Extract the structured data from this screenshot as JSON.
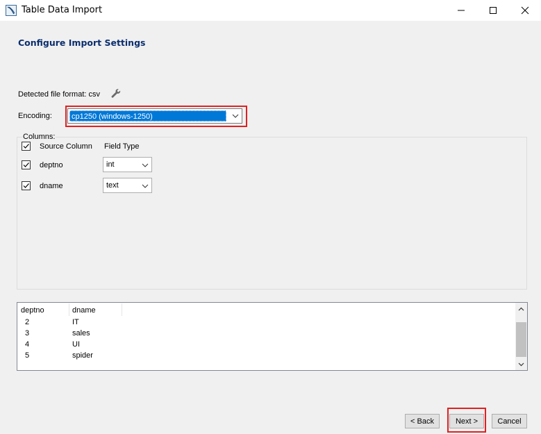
{
  "window": {
    "title": "Table Data Import"
  },
  "page": {
    "heading": "Configure Import Settings"
  },
  "detected_format": {
    "label": "Detected file format: csv",
    "icon": "wrench-icon"
  },
  "encoding": {
    "label": "Encoding:",
    "value": "cp1250 (windows-1250)"
  },
  "columns": {
    "group_label": "Columns:",
    "header_source": "Source Column",
    "header_type": "Field Type",
    "header_checked": true,
    "rows": [
      {
        "checked": true,
        "name": "deptno",
        "type": "int"
      },
      {
        "checked": true,
        "name": "dname",
        "type": "text"
      }
    ]
  },
  "preview": {
    "headers": [
      "deptno",
      "dname"
    ],
    "rows": [
      [
        "2",
        "IT"
      ],
      [
        "3",
        "sales"
      ],
      [
        "4",
        "UI"
      ],
      [
        "5",
        "spider"
      ]
    ]
  },
  "buttons": {
    "back": "< Back",
    "next": "Next >",
    "cancel": "Cancel"
  },
  "colors": {
    "heading": "#0b2e6e",
    "selection": "#0078d7",
    "highlight": "#e02020"
  }
}
